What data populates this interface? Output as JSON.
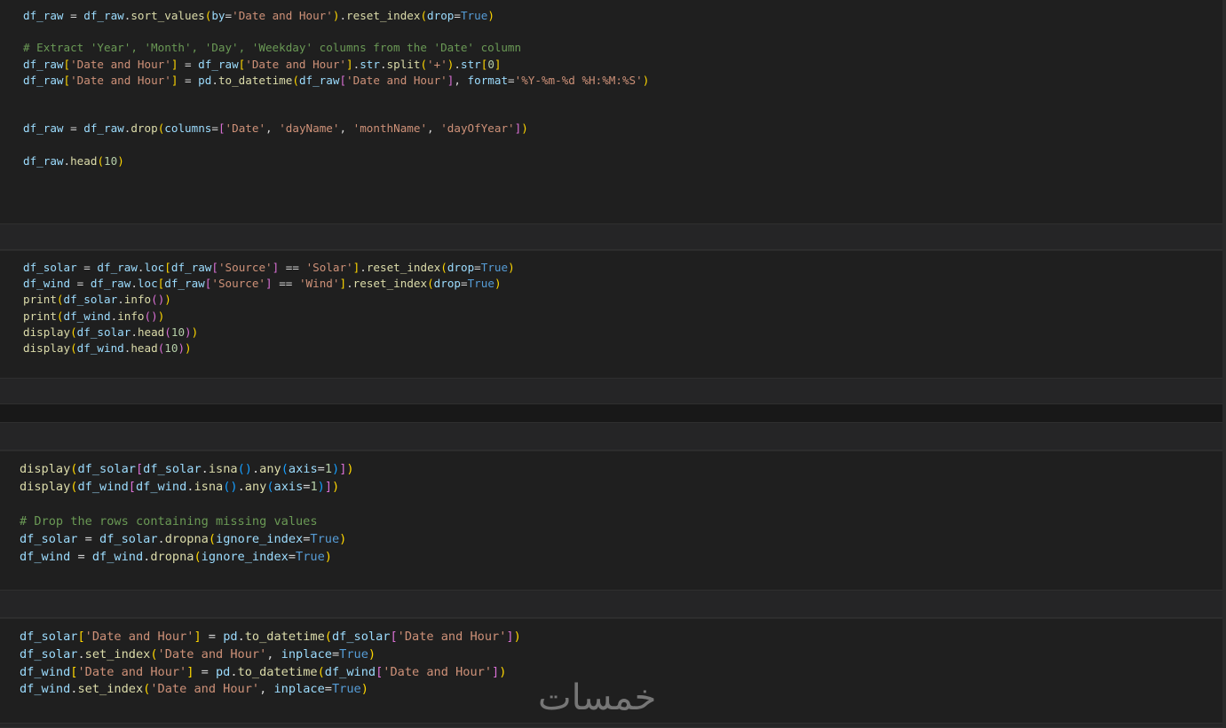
{
  "cells": [
    {
      "id": "cell-1",
      "lines": [
        [
          [
            "v",
            "df_raw"
          ],
          [
            "o",
            " = "
          ],
          [
            "v",
            "df_raw"
          ],
          [
            "o",
            "."
          ],
          [
            "f",
            "sort_values"
          ],
          [
            "b1",
            "("
          ],
          [
            "v",
            "by"
          ],
          [
            "o",
            "="
          ],
          [
            "s",
            "'Date and Hour'"
          ],
          [
            "b1",
            ")"
          ],
          [
            "o",
            "."
          ],
          [
            "f",
            "reset_index"
          ],
          [
            "b1",
            "("
          ],
          [
            "v",
            "drop"
          ],
          [
            "o",
            "="
          ],
          [
            "k",
            "True"
          ],
          [
            "b1",
            ")"
          ]
        ],
        [],
        [
          [
            "c",
            "# Extract 'Year', 'Month', 'Day', 'Weekday' columns from the 'Date' column"
          ]
        ],
        [
          [
            "v",
            "df_raw"
          ],
          [
            "b1",
            "["
          ],
          [
            "s",
            "'Date and Hour'"
          ],
          [
            "b1",
            "]"
          ],
          [
            "o",
            " = "
          ],
          [
            "v",
            "df_raw"
          ],
          [
            "b1",
            "["
          ],
          [
            "s",
            "'Date and Hour'"
          ],
          [
            "b1",
            "]"
          ],
          [
            "o",
            "."
          ],
          [
            "v",
            "str"
          ],
          [
            "o",
            "."
          ],
          [
            "f",
            "split"
          ],
          [
            "b1",
            "("
          ],
          [
            "s",
            "'+'"
          ],
          [
            "b1",
            ")"
          ],
          [
            "o",
            "."
          ],
          [
            "v",
            "str"
          ],
          [
            "b1",
            "["
          ],
          [
            "n",
            "0"
          ],
          [
            "b1",
            "]"
          ]
        ],
        [
          [
            "v",
            "df_raw"
          ],
          [
            "b1",
            "["
          ],
          [
            "s",
            "'Date and Hour'"
          ],
          [
            "b1",
            "]"
          ],
          [
            "o",
            " = "
          ],
          [
            "v",
            "pd"
          ],
          [
            "o",
            "."
          ],
          [
            "f",
            "to_datetime"
          ],
          [
            "b1",
            "("
          ],
          [
            "v",
            "df_raw"
          ],
          [
            "b2",
            "["
          ],
          [
            "s",
            "'Date and Hour'"
          ],
          [
            "b2",
            "]"
          ],
          [
            "o",
            ", "
          ],
          [
            "v",
            "format"
          ],
          [
            "o",
            "="
          ],
          [
            "s",
            "'%Y-%m-%d %H:%M:%S'"
          ],
          [
            "b1",
            ")"
          ]
        ],
        [],
        [],
        [
          [
            "v",
            "df_raw"
          ],
          [
            "o",
            " = "
          ],
          [
            "v",
            "df_raw"
          ],
          [
            "o",
            "."
          ],
          [
            "f",
            "drop"
          ],
          [
            "b1",
            "("
          ],
          [
            "v",
            "columns"
          ],
          [
            "o",
            "="
          ],
          [
            "b2",
            "["
          ],
          [
            "s",
            "'Date'"
          ],
          [
            "o",
            ", "
          ],
          [
            "s",
            "'dayName'"
          ],
          [
            "o",
            ", "
          ],
          [
            "s",
            "'monthName'"
          ],
          [
            "o",
            ", "
          ],
          [
            "s",
            "'dayOfYear'"
          ],
          [
            "b2",
            "]"
          ],
          [
            "b1",
            ")"
          ]
        ],
        [],
        [
          [
            "v",
            "df_raw"
          ],
          [
            "o",
            "."
          ],
          [
            "f",
            "head"
          ],
          [
            "b1",
            "("
          ],
          [
            "n",
            "10"
          ],
          [
            "b1",
            ")"
          ]
        ]
      ]
    },
    {
      "id": "cell-2",
      "lines": [
        [
          [
            "v",
            "df_solar"
          ],
          [
            "o",
            " = "
          ],
          [
            "v",
            "df_raw"
          ],
          [
            "o",
            "."
          ],
          [
            "v",
            "loc"
          ],
          [
            "b1",
            "["
          ],
          [
            "v",
            "df_raw"
          ],
          [
            "b2",
            "["
          ],
          [
            "s",
            "'Source'"
          ],
          [
            "b2",
            "]"
          ],
          [
            "o",
            " == "
          ],
          [
            "s",
            "'Solar'"
          ],
          [
            "b1",
            "]"
          ],
          [
            "o",
            "."
          ],
          [
            "f",
            "reset_index"
          ],
          [
            "b1",
            "("
          ],
          [
            "v",
            "drop"
          ],
          [
            "o",
            "="
          ],
          [
            "k",
            "True"
          ],
          [
            "b1",
            ")"
          ]
        ],
        [
          [
            "v",
            "df_wind"
          ],
          [
            "o",
            " = "
          ],
          [
            "v",
            "df_raw"
          ],
          [
            "o",
            "."
          ],
          [
            "v",
            "loc"
          ],
          [
            "b1",
            "["
          ],
          [
            "v",
            "df_raw"
          ],
          [
            "b2",
            "["
          ],
          [
            "s",
            "'Source'"
          ],
          [
            "b2",
            "]"
          ],
          [
            "o",
            " == "
          ],
          [
            "s",
            "'Wind'"
          ],
          [
            "b1",
            "]"
          ],
          [
            "o",
            "."
          ],
          [
            "f",
            "reset_index"
          ],
          [
            "b1",
            "("
          ],
          [
            "v",
            "drop"
          ],
          [
            "o",
            "="
          ],
          [
            "k",
            "True"
          ],
          [
            "b1",
            ")"
          ]
        ],
        [
          [
            "f",
            "print"
          ],
          [
            "b1",
            "("
          ],
          [
            "v",
            "df_solar"
          ],
          [
            "o",
            "."
          ],
          [
            "f",
            "info"
          ],
          [
            "b2",
            "()"
          ],
          [
            "b1",
            ")"
          ]
        ],
        [
          [
            "f",
            "print"
          ],
          [
            "b1",
            "("
          ],
          [
            "v",
            "df_wind"
          ],
          [
            "o",
            "."
          ],
          [
            "f",
            "info"
          ],
          [
            "b2",
            "()"
          ],
          [
            "b1",
            ")"
          ]
        ],
        [
          [
            "f",
            "display"
          ],
          [
            "b1",
            "("
          ],
          [
            "v",
            "df_solar"
          ],
          [
            "o",
            "."
          ],
          [
            "f",
            "head"
          ],
          [
            "b2",
            "("
          ],
          [
            "n",
            "10"
          ],
          [
            "b2",
            ")"
          ],
          [
            "b1",
            ")"
          ]
        ],
        [
          [
            "f",
            "display"
          ],
          [
            "b1",
            "("
          ],
          [
            "v",
            "df_wind"
          ],
          [
            "o",
            "."
          ],
          [
            "f",
            "head"
          ],
          [
            "b2",
            "("
          ],
          [
            "n",
            "10"
          ],
          [
            "b2",
            ")"
          ],
          [
            "b1",
            ")"
          ]
        ]
      ]
    },
    {
      "id": "cell-3",
      "lines": [
        [
          [
            "f",
            "display"
          ],
          [
            "b1",
            "("
          ],
          [
            "v",
            "df_solar"
          ],
          [
            "b2",
            "["
          ],
          [
            "v",
            "df_solar"
          ],
          [
            "o",
            "."
          ],
          [
            "f",
            "isna"
          ],
          [
            "b3",
            "()"
          ],
          [
            "o",
            "."
          ],
          [
            "f",
            "any"
          ],
          [
            "b3",
            "("
          ],
          [
            "v",
            "axis"
          ],
          [
            "o",
            "="
          ],
          [
            "n",
            "1"
          ],
          [
            "b3",
            ")"
          ],
          [
            "b2",
            "]"
          ],
          [
            "b1",
            ")"
          ]
        ],
        [
          [
            "f",
            "display"
          ],
          [
            "b1",
            "("
          ],
          [
            "v",
            "df_wind"
          ],
          [
            "b2",
            "["
          ],
          [
            "v",
            "df_wind"
          ],
          [
            "o",
            "."
          ],
          [
            "f",
            "isna"
          ],
          [
            "b3",
            "()"
          ],
          [
            "o",
            "."
          ],
          [
            "f",
            "any"
          ],
          [
            "b3",
            "("
          ],
          [
            "v",
            "axis"
          ],
          [
            "o",
            "="
          ],
          [
            "n",
            "1"
          ],
          [
            "b3",
            ")"
          ],
          [
            "b2",
            "]"
          ],
          [
            "b1",
            ")"
          ]
        ],
        [],
        [
          [
            "c",
            "# Drop the rows containing missing values"
          ]
        ],
        [
          [
            "v",
            "df_solar"
          ],
          [
            "o",
            " = "
          ],
          [
            "v",
            "df_solar"
          ],
          [
            "o",
            "."
          ],
          [
            "f",
            "dropna"
          ],
          [
            "b1",
            "("
          ],
          [
            "v",
            "ignore_index"
          ],
          [
            "o",
            "="
          ],
          [
            "k",
            "True"
          ],
          [
            "b1",
            ")"
          ]
        ],
        [
          [
            "v",
            "df_wind"
          ],
          [
            "o",
            " = "
          ],
          [
            "v",
            "df_wind"
          ],
          [
            "o",
            "."
          ],
          [
            "f",
            "dropna"
          ],
          [
            "b1",
            "("
          ],
          [
            "v",
            "ignore_index"
          ],
          [
            "o",
            "="
          ],
          [
            "k",
            "True"
          ],
          [
            "b1",
            ")"
          ]
        ]
      ]
    },
    {
      "id": "cell-4",
      "lines": [
        [
          [
            "v",
            "df_solar"
          ],
          [
            "b1",
            "["
          ],
          [
            "s",
            "'Date and Hour'"
          ],
          [
            "b1",
            "]"
          ],
          [
            "o",
            " = "
          ],
          [
            "v",
            "pd"
          ],
          [
            "o",
            "."
          ],
          [
            "f",
            "to_datetime"
          ],
          [
            "b1",
            "("
          ],
          [
            "v",
            "df_solar"
          ],
          [
            "b2",
            "["
          ],
          [
            "s",
            "'Date and Hour'"
          ],
          [
            "b2",
            "]"
          ],
          [
            "b1",
            ")"
          ]
        ],
        [
          [
            "v",
            "df_solar"
          ],
          [
            "o",
            "."
          ],
          [
            "f",
            "set_index"
          ],
          [
            "b1",
            "("
          ],
          [
            "s",
            "'Date and Hour'"
          ],
          [
            "o",
            ", "
          ],
          [
            "v",
            "inplace"
          ],
          [
            "o",
            "="
          ],
          [
            "k",
            "True"
          ],
          [
            "b1",
            ")"
          ]
        ],
        [
          [
            "v",
            "df_wind"
          ],
          [
            "b1",
            "["
          ],
          [
            "s",
            "'Date and Hour'"
          ],
          [
            "b1",
            "]"
          ],
          [
            "o",
            " = "
          ],
          [
            "v",
            "pd"
          ],
          [
            "o",
            "."
          ],
          [
            "f",
            "to_datetime"
          ],
          [
            "b1",
            "("
          ],
          [
            "v",
            "df_wind"
          ],
          [
            "b2",
            "["
          ],
          [
            "s",
            "'Date and Hour'"
          ],
          [
            "b2",
            "]"
          ],
          [
            "b1",
            ")"
          ]
        ],
        [
          [
            "v",
            "df_wind"
          ],
          [
            "o",
            "."
          ],
          [
            "f",
            "set_index"
          ],
          [
            "b1",
            "("
          ],
          [
            "s",
            "'Date and Hour'"
          ],
          [
            "o",
            ", "
          ],
          [
            "v",
            "inplace"
          ],
          [
            "o",
            "="
          ],
          [
            "k",
            "True"
          ],
          [
            "b1",
            ")"
          ]
        ]
      ]
    }
  ],
  "watermark": "خمسات",
  "colors": {
    "background": "#1f1f1f",
    "variable": "#9cdcfe",
    "function": "#dcdcaa",
    "string": "#ce9178",
    "keyword": "#569cd6",
    "number": "#b5cea8",
    "comment": "#6a9955",
    "bracket_level_1": "#ffd700",
    "bracket_level_2": "#da70d6",
    "bracket_level_3": "#179fff"
  }
}
